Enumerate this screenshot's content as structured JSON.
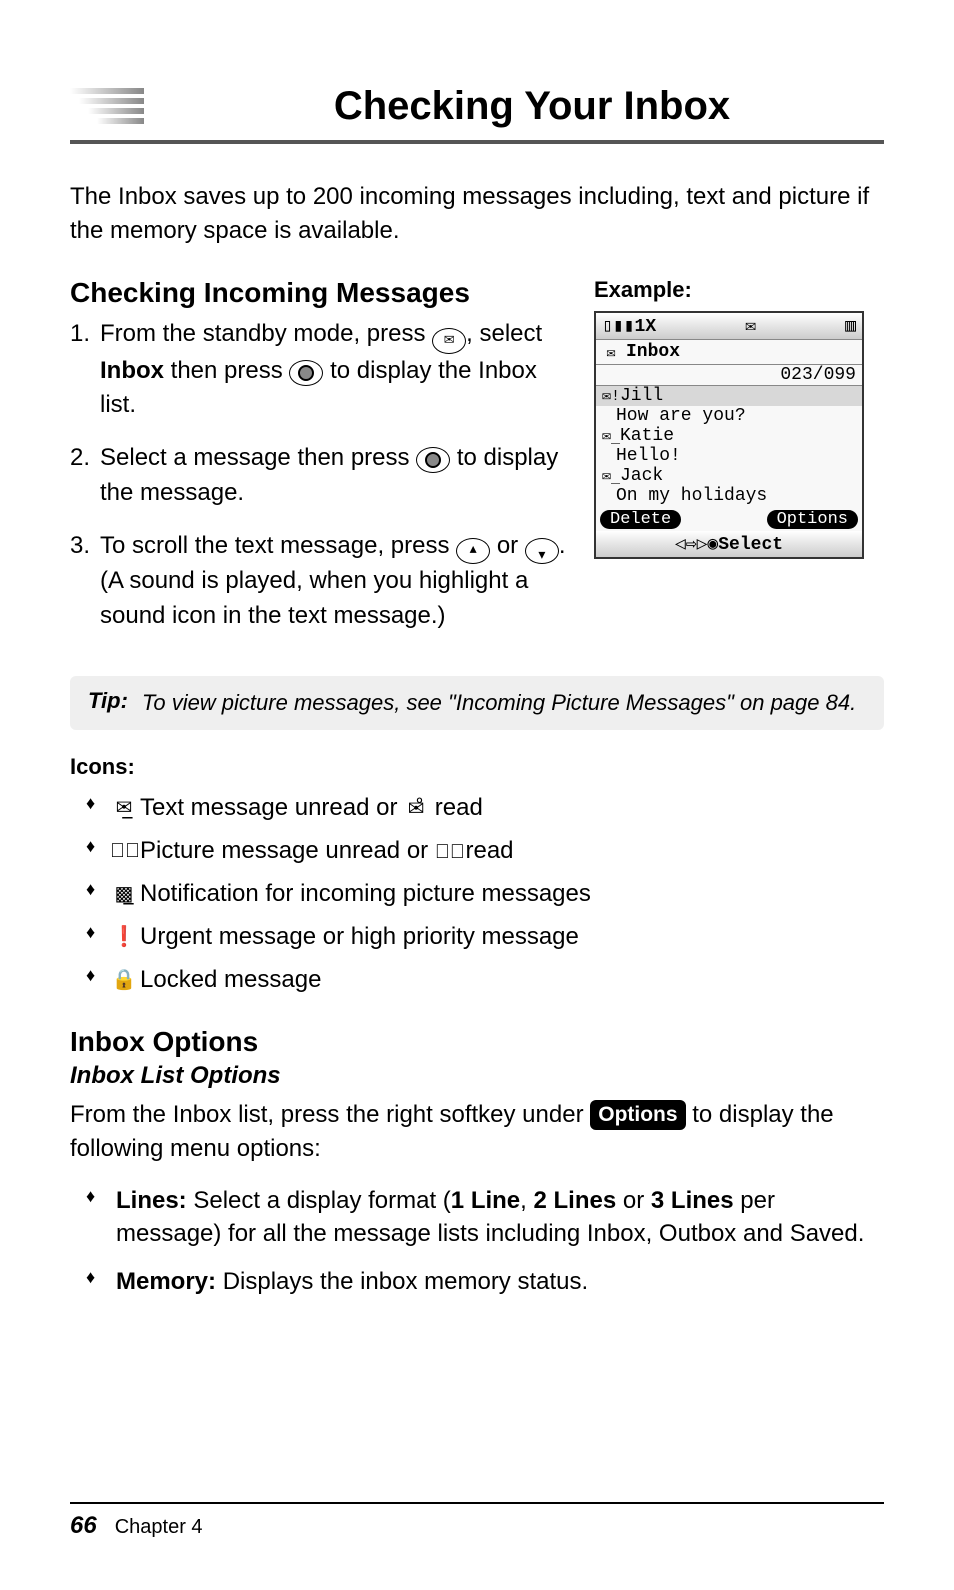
{
  "page": {
    "title": "Checking Your Inbox",
    "intro": "The Inbox saves up to 200 incoming messages including, text and picture if the memory space is available."
  },
  "section1": {
    "heading": "Checking Incoming Messages",
    "steps": {
      "s1a": "From the standby mode, press ",
      "s1b": ", select ",
      "s1c": "Inbox",
      "s1d": " then press ",
      "s1e": " to display the Inbox list.",
      "s2a": "Select a message then press ",
      "s2b": " to display the message.",
      "s3a": "To scroll the text message, press ",
      "s3b": " or ",
      "s3c": ". (A sound is played, when you highlight a sound icon in the text message.)"
    }
  },
  "example": {
    "label": "Example:",
    "status_left": "▯▮▮1X",
    "status_mid": "✉",
    "status_right": "▥",
    "title_icon": "✉",
    "title": "Inbox",
    "counter": "023/099",
    "rows": [
      {
        "icon": "✉!",
        "name": "Jill",
        "preview": "How are you?"
      },
      {
        "icon": "✉̲",
        "name": "Katie",
        "preview": "Hello!"
      },
      {
        "icon": "✉̲",
        "name": "Jack",
        "preview": "On my holidays"
      }
    ],
    "softkey_left": "Delete",
    "softkey_right": "Options",
    "bottom": "◁⇨▷◉Select"
  },
  "tip": {
    "label": "Tip:",
    "text": "To view picture messages, see \"Incoming Picture Messages\" on page 84."
  },
  "icons_section": {
    "heading": "Icons:",
    "items": {
      "i1a": "Text message unread or ",
      "i1b": " read",
      "i2a": "Picture message unread or ",
      "i2b": " read",
      "i3": "Notification for incoming picture messages",
      "i4": "Urgent message or high priority message",
      "i5": "Locked message"
    }
  },
  "section2": {
    "heading": "Inbox Options",
    "sub": "Inbox List Options",
    "para_a": "From the Inbox list, press the right softkey under ",
    "options_pill": "Options",
    "para_b": " to display the following menu options:",
    "bullets": {
      "b1_label": "Lines:",
      "b1_a": " Select a display format (",
      "b1_b": "1 Line",
      "b1_c": ", ",
      "b1_d": "2 Lines",
      "b1_e": " or ",
      "b1_f": "3 Lines",
      "b1_g": " per message) for all the message lists including Inbox, Outbox and Saved.",
      "b2_label": "Memory:",
      "b2_a": " Displays the inbox memory status."
    }
  },
  "footer": {
    "page_number": "66",
    "chapter": "Chapter 4"
  }
}
